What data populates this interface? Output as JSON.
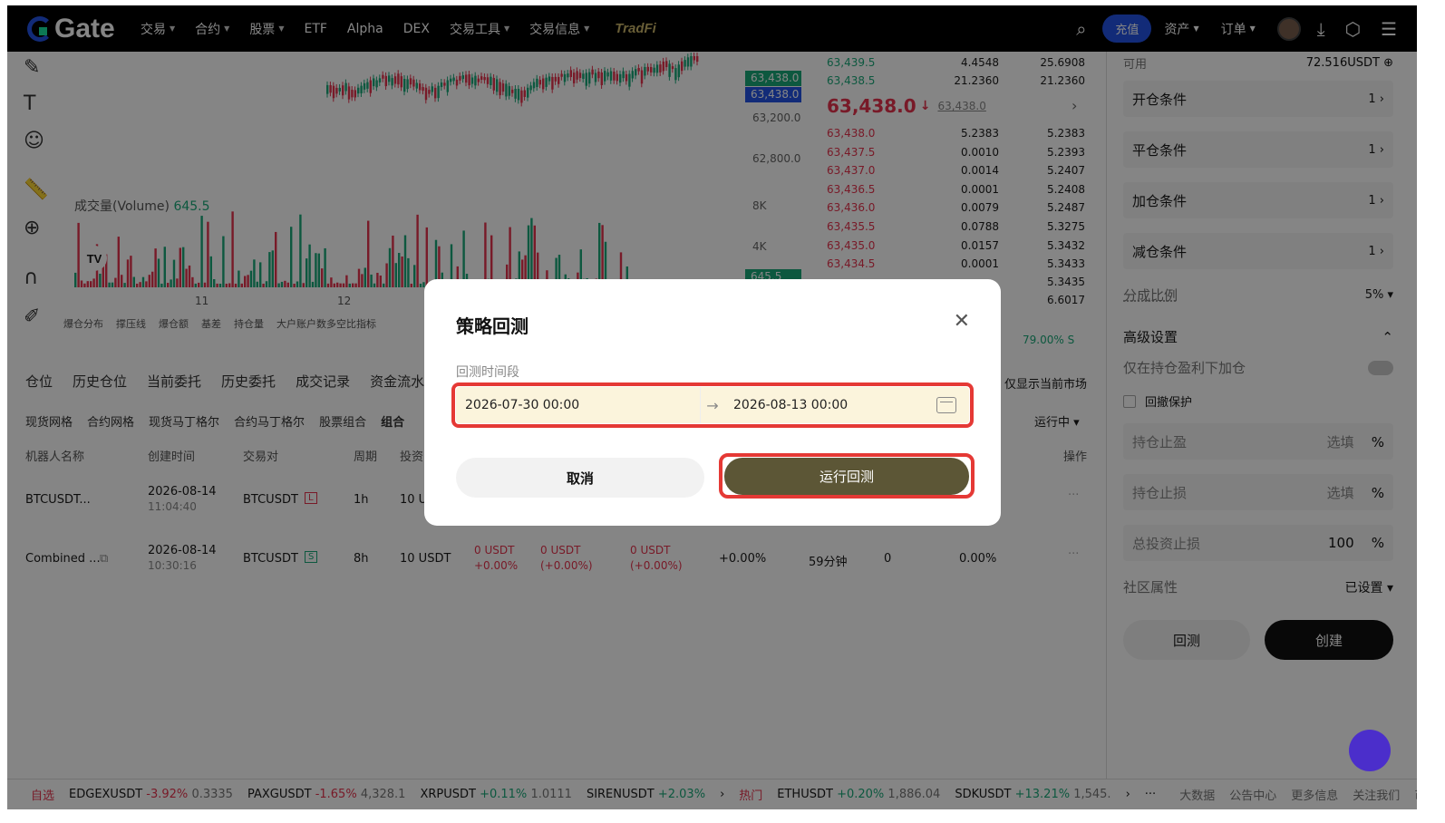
{
  "nav": {
    "logo_text": "Gate",
    "items": [
      "交易",
      "合约",
      "股票",
      "ETF",
      "Alpha",
      "DEX",
      "交易工具",
      "交易信息"
    ],
    "tradfi": "TradFi",
    "recharge": "充值",
    "assets": "资产",
    "orders": "订单"
  },
  "chart": {
    "volume_label": "成交量(Volume)",
    "volume_value": "645.5",
    "x_ticks": [
      "11",
      "12"
    ],
    "bottom_tools": [
      "爆仓分布",
      "撑压线",
      "爆仓额",
      "基差",
      "持仓量",
      "大户账户数多空比指标"
    ],
    "price_ticks": [
      "63,200.0",
      "62,800.0",
      "8K",
      "4K"
    ],
    "price_tag_1": "63,438.0",
    "price_tag_2": "63,438.0",
    "vol_tag": "645.5"
  },
  "orderbook": {
    "asks_top": [
      {
        "price": "63,439.5",
        "qty": "4.4548",
        "total": "25.6908"
      },
      {
        "price": "63,438.5",
        "qty": "21.2360",
        "total": "21.2360"
      }
    ],
    "mid_price": "63,438.0",
    "mid_arrow": "↓",
    "mark_price": "63,438.0",
    "bids": [
      {
        "price": "63,438.0",
        "qty": "5.2383",
        "total": "5.2383"
      },
      {
        "price": "63,437.5",
        "qty": "0.0010",
        "total": "5.2393"
      },
      {
        "price": "63,437.0",
        "qty": "0.0014",
        "total": "5.2407"
      },
      {
        "price": "63,436.5",
        "qty": "0.0001",
        "total": "5.2408"
      },
      {
        "price": "63,436.0",
        "qty": "0.0079",
        "total": "5.2487"
      },
      {
        "price": "63,435.5",
        "qty": "0.0788",
        "total": "5.3275"
      },
      {
        "price": "63,435.0",
        "qty": "0.0157",
        "total": "5.3432"
      },
      {
        "price": "63,434.5",
        "qty": "0.0001",
        "total": "5.3433"
      }
    ],
    "extra_totals": [
      "5.3435",
      "6.6017"
    ],
    "ratio": "79.00%",
    "ratio_suffix": "S"
  },
  "right_panel": {
    "available_label": "可用",
    "available_value": "72.516USDT",
    "conditions": [
      {
        "label": "开仓条件",
        "count": "1"
      },
      {
        "label": "平仓条件",
        "count": "1"
      },
      {
        "label": "加仓条件",
        "count": "1"
      },
      {
        "label": "减仓条件",
        "count": "1"
      }
    ],
    "split_label": "分成比例",
    "split_value": "5%",
    "advanced_label": "高级设置",
    "only_profit_label": "仅在持仓盈利下加仓",
    "drawdown_label": "回撤保护",
    "take_profit_label": "持仓止盈",
    "stop_loss_label": "持仓止损",
    "optional": "选填",
    "percent": "%",
    "total_stop_label": "总投资止损",
    "total_stop_value": "100",
    "community_label": "社区属性",
    "community_value": "已设置",
    "backtest_btn": "回测",
    "create_btn": "创建"
  },
  "bottom": {
    "tabs": [
      "仓位",
      "历史仓位",
      "当前委托",
      "历史委托",
      "成交记录",
      "资金流水"
    ],
    "show_current_market": "仅显示当前市场",
    "subtabs": [
      "现货网格",
      "合约网格",
      "现货马丁格尔",
      "合约马丁格尔",
      "股票组合",
      "组合"
    ],
    "status_filter": "运行中",
    "headers": [
      "机器人名称",
      "创建时间",
      "交易对",
      "周期",
      "投资",
      "操作"
    ],
    "rows": [
      {
        "name": "BTCUSDT...",
        "date": "2026-08-14",
        "time": "11:04:40",
        "pair": "BTCUSDT",
        "tag": "L",
        "period": "1h",
        "invest": "10 U"
      },
      {
        "name": "Combined ...",
        "date": "2026-08-14",
        "time": "10:30:16",
        "pair": "BTCUSDT",
        "tag": "S",
        "period": "8h",
        "invest": "10 USDT",
        "c1a": "0 USDT",
        "c1b": "+0.00%",
        "c2a": "0 USDT",
        "c2b": "(+0.00%)",
        "c3a": "0 USDT",
        "c3b": "(+0.00%)",
        "c4": "+0.00%",
        "c5": "59分钟",
        "c6": "0",
        "c7": "0.00%"
      }
    ]
  },
  "ticker": {
    "fav": "自选",
    "hot": "热门",
    "items": [
      {
        "sym": "EDGEXUSDT",
        "chg": "-3.92%",
        "price": "0.3335"
      },
      {
        "sym": "PAXGUSDT",
        "chg": "-1.65%",
        "price": "4,328.1"
      },
      {
        "sym": "XRPUSDT",
        "chg": "+0.11%",
        "price": "1.0111"
      },
      {
        "sym": "SIRENUSDT",
        "chg": "+2.03%",
        "price": ""
      },
      {
        "sym": "ETHUSDT",
        "chg": "+0.20%",
        "price": "1,886.04"
      },
      {
        "sym": "SDKUSDT",
        "chg": "+13.21%",
        "price": "1,545."
      }
    ],
    "links": [
      "大数据",
      "公告中心",
      "更多信息",
      "关注我们",
      "币圈"
    ]
  },
  "modal": {
    "title": "策略回测",
    "period_label": "回测时间段",
    "start": "2026-07-30 00:00",
    "end": "2026-08-13 00:00",
    "cancel": "取消",
    "run": "运行回测"
  }
}
